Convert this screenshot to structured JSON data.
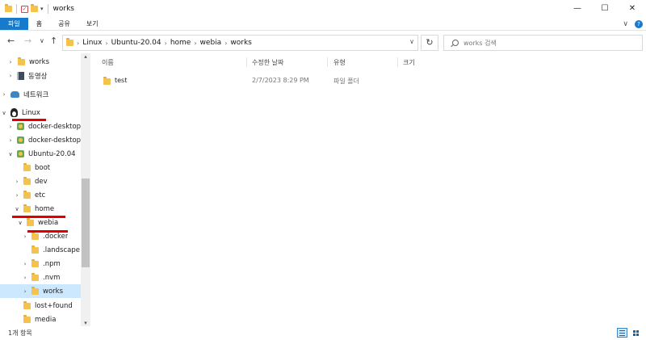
{
  "window": {
    "title": "works",
    "minimize": "—",
    "maximize": "☐",
    "close": "✕"
  },
  "ribbon": {
    "tabs": [
      "파일",
      "홈",
      "공유",
      "보기"
    ],
    "expand": "∨",
    "help": "?"
  },
  "nav": {
    "back": "←",
    "forward": "→",
    "recent": "∨",
    "up": "↑"
  },
  "address": {
    "crumbs": [
      "Linux",
      "Ubuntu-20.04",
      "home",
      "webia",
      "works"
    ],
    "dropdown": "∨",
    "refresh": "↻"
  },
  "search": {
    "placeholder": "works 검색"
  },
  "tree": [
    {
      "label": "works",
      "chev": "›",
      "icon": "folder-icon"
    },
    {
      "label": "동영상",
      "chev": "›",
      "icon": "video-icon"
    },
    {
      "label": "네트워크",
      "chev": "›",
      "icon": "network-icon"
    },
    {
      "label": "Linux",
      "chev": "∨",
      "icon": "linux-icon"
    },
    {
      "label": "docker-desktop",
      "chev": "›",
      "icon": "distro-icon"
    },
    {
      "label": "docker-desktop-",
      "chev": "›",
      "icon": "distro-icon"
    },
    {
      "label": "Ubuntu-20.04",
      "chev": "∨",
      "icon": "distro-icon"
    },
    {
      "label": "boot",
      "chev": "",
      "icon": "folder-icon"
    },
    {
      "label": "dev",
      "chev": "›",
      "icon": "folder-icon"
    },
    {
      "label": "etc",
      "chev": "›",
      "icon": "folder-icon"
    },
    {
      "label": "home",
      "chev": "∨",
      "icon": "folder-icon"
    },
    {
      "label": "webia",
      "chev": "∨",
      "icon": "folder-icon"
    },
    {
      "label": ".docker",
      "chev": "›",
      "icon": "folder-icon"
    },
    {
      "label": ".landscape",
      "chev": "",
      "icon": "folder-icon"
    },
    {
      "label": ".npm",
      "chev": "›",
      "icon": "folder-icon"
    },
    {
      "label": ".nvm",
      "chev": "›",
      "icon": "folder-icon"
    },
    {
      "label": "works",
      "chev": "›",
      "icon": "folder-icon",
      "selected": true
    },
    {
      "label": "lost+found",
      "chev": "",
      "icon": "folder-icon"
    },
    {
      "label": "media",
      "chev": "",
      "icon": "folder-icon"
    }
  ],
  "columns": [
    "이름",
    "수정한 날짜",
    "유형",
    "크기"
  ],
  "files": [
    {
      "name": "test",
      "modified": "2/7/2023 8:29 PM",
      "type": "파일 폴더",
      "size": ""
    }
  ],
  "status": {
    "item_count": "1개 항목"
  },
  "scroll": {
    "up": "▴",
    "down": "▾"
  },
  "colors": {
    "accent": "#1979ca",
    "selection": "#cce8ff",
    "annotation": "#e00000",
    "folder": "#f4c24e"
  }
}
